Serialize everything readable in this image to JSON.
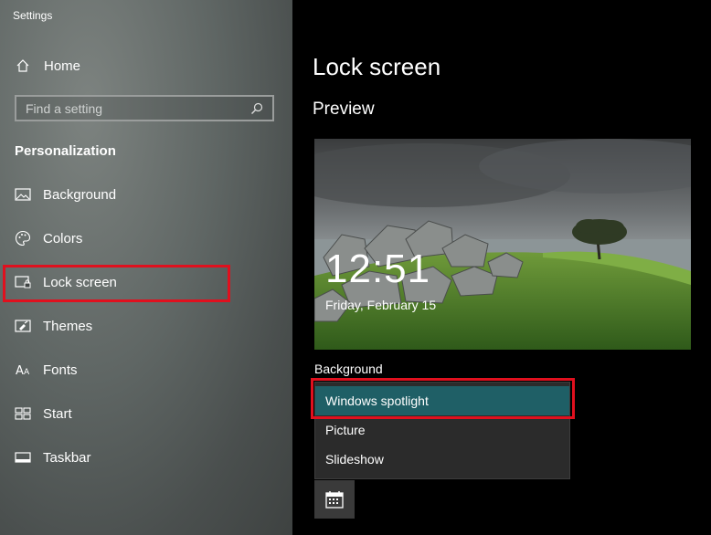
{
  "window": {
    "title": "Settings"
  },
  "sidebar": {
    "home_label": "Home",
    "search_placeholder": "Find a setting",
    "section_title": "Personalization",
    "items": [
      {
        "label": "Background",
        "icon": "image-icon"
      },
      {
        "label": "Colors",
        "icon": "palette-icon"
      },
      {
        "label": "Lock screen",
        "icon": "lock-screen-icon"
      },
      {
        "label": "Themes",
        "icon": "themes-icon"
      },
      {
        "label": "Fonts",
        "icon": "fonts-icon"
      },
      {
        "label": "Start",
        "icon": "start-icon"
      },
      {
        "label": "Taskbar",
        "icon": "taskbar-icon"
      }
    ]
  },
  "main": {
    "title": "Lock screen",
    "preview_heading": "Preview",
    "preview": {
      "time": "12:51",
      "date": "Friday, February 15"
    },
    "background_label": "Background",
    "dropdown": {
      "options": [
        "Windows spotlight",
        "Picture",
        "Slideshow"
      ],
      "selected": "Windows spotlight"
    }
  },
  "colors": {
    "accent": "#1f5f66",
    "annotation": "#e0101e"
  }
}
